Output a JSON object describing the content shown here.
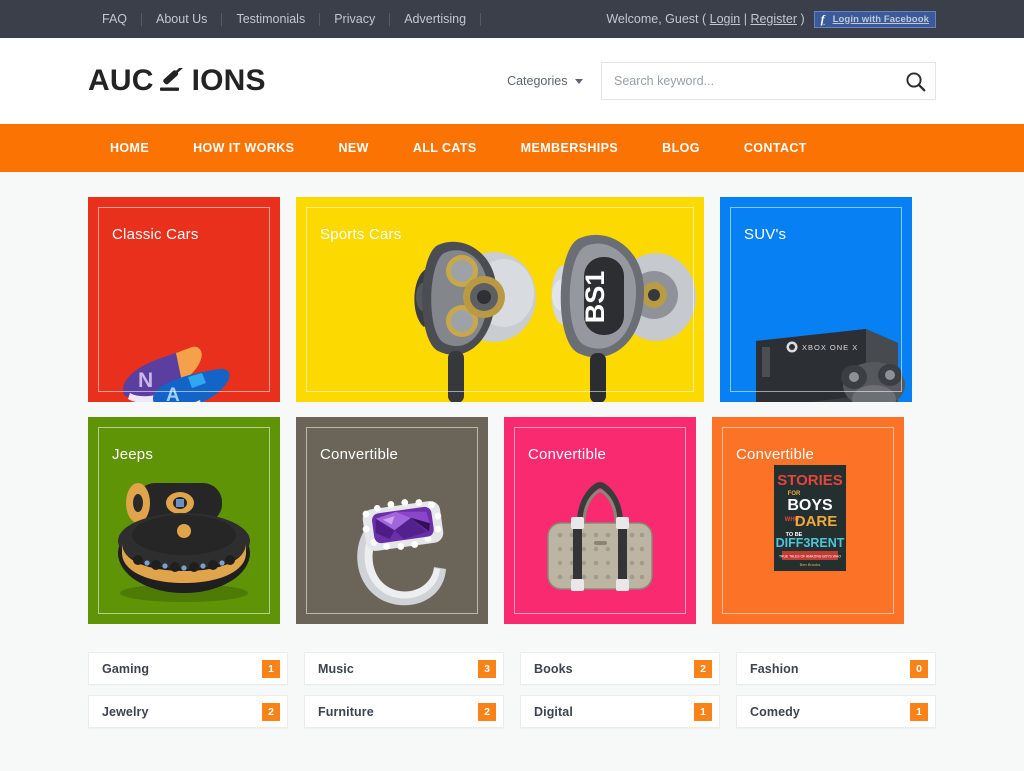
{
  "topbar": {
    "links": [
      "FAQ",
      "About Us",
      "Testimonials",
      "Privacy",
      "Advertising"
    ],
    "welcome_prefix": "Welcome, Guest ( ",
    "login_label": "Login",
    "divider": " | ",
    "register_label": "Register",
    "welcome_suffix": " )",
    "facebook_button": "Login with Facebook",
    "facebook_icon": "facebook-f-icon",
    "bg_color": "#3a3f4a"
  },
  "header": {
    "logo_part1": "AUC",
    "logo_icon": "gavel-icon",
    "logo_part2": "IONS",
    "categories_label": "Categories",
    "search_placeholder": "Search keyword...",
    "search_value": "",
    "search_icon": "search-icon"
  },
  "nav": {
    "items": [
      "HOME",
      "HOW IT WORKS",
      "NEW",
      "ALL CATS",
      "MEMBERSHIPS",
      "BLOG",
      "CONTACT"
    ],
    "bg_color": "#fb7302"
  },
  "tiles": {
    "row1": [
      {
        "title": "Classic Cars",
        "color": "#e8301d",
        "art": "sneakers"
      },
      {
        "title": "Sports Cars",
        "color": "#fcd900",
        "art": "earbuds"
      },
      {
        "title": "SUV's",
        "color": "#0680f3",
        "art": "xbox-console"
      }
    ],
    "row2": [
      {
        "title": "Jeeps",
        "color": "#5f9406",
        "art": "ottoman-chair"
      },
      {
        "title": "Convertible",
        "color": "#6b6458",
        "art": "amethyst-ring"
      },
      {
        "title": "Convertible",
        "color": "#fa2a70",
        "art": "handbag"
      },
      {
        "title": "Convertible",
        "color": "#fc7227",
        "art": "book-cover"
      }
    ],
    "earbud_label": "BS1",
    "book": {
      "line1": "STORIES",
      "line2": "FOR",
      "line3": "BOYS",
      "line4": "WHO",
      "line5": "DARE",
      "line6": "TO BE",
      "line7": "DIFFERENT",
      "sub": "TRUE TALES OF AMAZING BOYS WHO",
      "sub2": "CHANGED THE WORLD WITHOUT KILLING DRAGONS",
      "author": "Ben Brooks"
    },
    "xbox_label": "XBOX ONE X"
  },
  "categories": [
    {
      "name": "Gaming",
      "count": "1"
    },
    {
      "name": "Music",
      "count": "3"
    },
    {
      "name": "Books",
      "count": "2"
    },
    {
      "name": "Fashion",
      "count": "0"
    },
    {
      "name": "Jewelry",
      "count": "2"
    },
    {
      "name": "Furniture",
      "count": "2"
    },
    {
      "name": "Digital",
      "count": "1"
    },
    {
      "name": "Comedy",
      "count": "1"
    }
  ],
  "accent_color": "#f98318"
}
